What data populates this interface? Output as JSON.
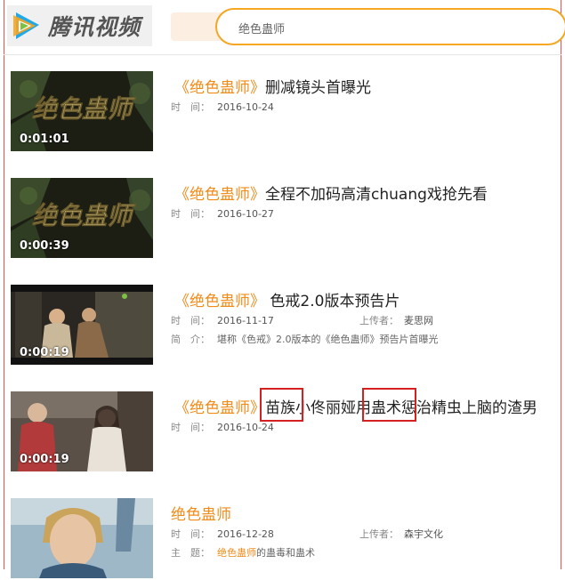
{
  "header": {
    "logo_text": "腾讯视频",
    "search_value": "绝色蛊师"
  },
  "meta_labels": {
    "time": "时　间：",
    "uploader": "上传者：",
    "intro": "简　介：",
    "topic": "主　题："
  },
  "results": [
    {
      "duration": "0:01:01",
      "title_open": "《",
      "title_keyword": "绝色蛊师",
      "title_close": "》",
      "title_rest": "删减镜头首曝光",
      "time": "2016-10-24",
      "thumb_caption": "绝色蛊师"
    },
    {
      "duration": "0:00:39",
      "title_open": "《",
      "title_keyword": "绝色蛊师",
      "title_close": "》",
      "title_rest": "全程不加码高清chuang戏抢先看",
      "time": "2016-10-27",
      "thumb_caption": "绝色蛊师"
    },
    {
      "duration": "0:00:19",
      "title_open": "《",
      "title_keyword": "绝色蛊师",
      "title_close": "》",
      "title_rest": " 色戒2.0版本预告片",
      "time": "2016-11-17",
      "uploader": "麦思网",
      "intro": "堪称《色戒》2.0版本的《绝色蛊师》预告片首曝光"
    },
    {
      "duration": "0:00:19",
      "title_open": "《",
      "title_keyword": "绝色蛊师",
      "title_close": "》",
      "title_rest": "苗族小佟丽娅用蛊术惩治精虫上脑的渣男",
      "time": "2016-10-24"
    },
    {
      "title_keyword": "绝色蛊师",
      "time": "2016-12-28",
      "uploader": "森宇文化",
      "topic_keyword": "绝色蛊师",
      "topic_rest": "的蛊毒和蛊术"
    }
  ],
  "colors": {
    "accent": "#f08c1a",
    "search_border": "#f5a623",
    "annotation_red": "#d42020",
    "frame_red": "#d85a5a"
  }
}
